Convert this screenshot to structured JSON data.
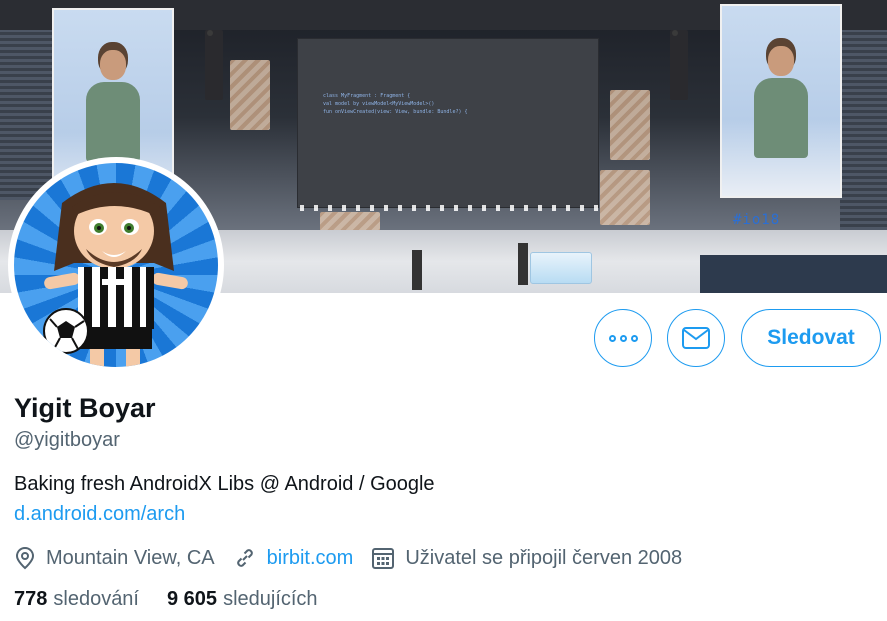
{
  "profile": {
    "name": "Yigit Boyar",
    "handle": "@yigitboyar",
    "bio": "Baking fresh AndroidX Libs @ Android / Google",
    "bio_link": "d.android.com/arch"
  },
  "actions": {
    "more_icon": "more-horizontal-icon",
    "message_icon": "envelope-icon",
    "follow_label": "Sledovat"
  },
  "meta": {
    "location": "Mountain View, CA",
    "location_icon": "map-pin-icon",
    "website": "birbit.com",
    "website_icon": "link-icon",
    "joined": "Uživatel se připojil červen 2008",
    "joined_icon": "calendar-icon"
  },
  "stats": {
    "following_count": "778",
    "following_label": "sledování",
    "followers_count": "9 605",
    "followers_label": "sledujících"
  },
  "banner": {
    "code_lines": [
      "class MyFragment : Fragment {",
      "  val model by viewModel<MyViewModel>()",
      "  fun onViewCreated(view: View, bundle: Bundle?) {"
    ],
    "io_logo": "#io18"
  },
  "colors": {
    "accent": "#1d9bf0",
    "text_primary": "#0f1419",
    "text_secondary": "#536471"
  }
}
